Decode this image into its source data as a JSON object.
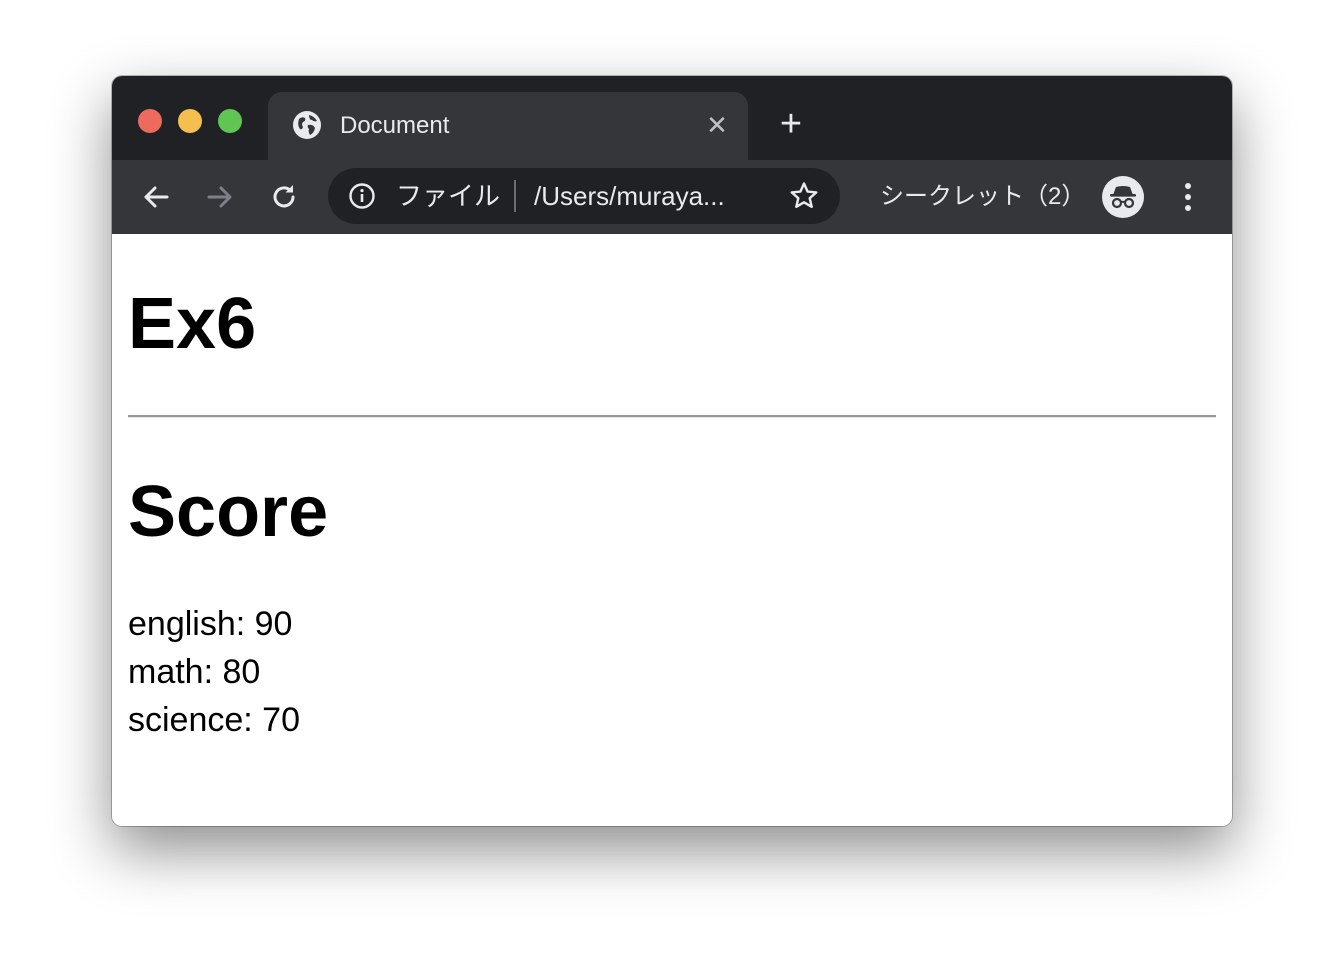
{
  "browser": {
    "tab": {
      "title": "Document",
      "close_glyph": "✕",
      "favicon": "globe-icon"
    },
    "new_tab_glyph": "+",
    "address": {
      "scheme_label": "ファイル",
      "url": "/Users/muraya..."
    },
    "incognito_label": "シークレット（2）",
    "colors": {
      "tabstrip": "#202124",
      "toolbar": "#35363a",
      "omnibox": "#202124",
      "traffic_red": "#ed6a5e",
      "traffic_yellow": "#f4bf4f",
      "traffic_green": "#61c554"
    }
  },
  "page": {
    "heading": "Ex6",
    "subheading": "Score",
    "scores": [
      "english: 90",
      "math: 80",
      "science: 70"
    ]
  }
}
